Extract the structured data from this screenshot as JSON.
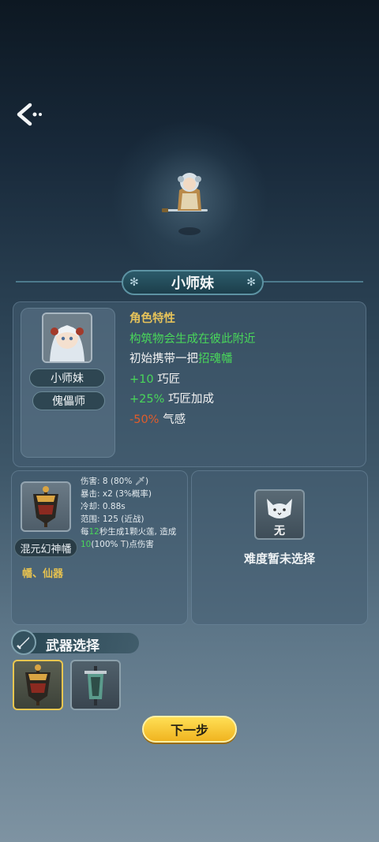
{
  "header": {
    "back_icon": "back-arrow-icon"
  },
  "character": {
    "name": "小师妹",
    "portrait_name": "小师妹",
    "class": "傀儡师"
  },
  "traits": {
    "title": "角色特性",
    "line1": "构筑物会生成在彼此附近",
    "line2_prefix": "初始携带一把",
    "line2_item": "招魂幡",
    "line3_value": "+10",
    "line3_label": "巧匠",
    "line4_value": "+25%",
    "line4_label": "巧匠加成",
    "line5_value": "-50%",
    "line5_label": "气感"
  },
  "weapon": {
    "name": "混元幻神幡",
    "tags": "幡、仙器",
    "stats": {
      "damage": "伤害: 8 (80%",
      "damage_close": ")",
      "crit": "暴击: x2 (3%概率)",
      "cooldown": "冷却: 0.88s",
      "range": "范围: 125 (近战)",
      "effect_a": "每",
      "effect_b": "12",
      "effect_c": "秒生成1颗火莲, 造成",
      "effect_d": "10",
      "effect_e": "(100%",
      "effect_f": ")点伤害"
    }
  },
  "difficulty": {
    "badge": "无",
    "text": "难度暂未选择",
    "icon": "cat-icon"
  },
  "weapon_select": {
    "title": "武器选择",
    "icon": "sword-icon"
  },
  "next_button": "下一步",
  "colors": {
    "accent": "#e9c650",
    "green": "#49d65a",
    "orange": "#e25c2a"
  }
}
